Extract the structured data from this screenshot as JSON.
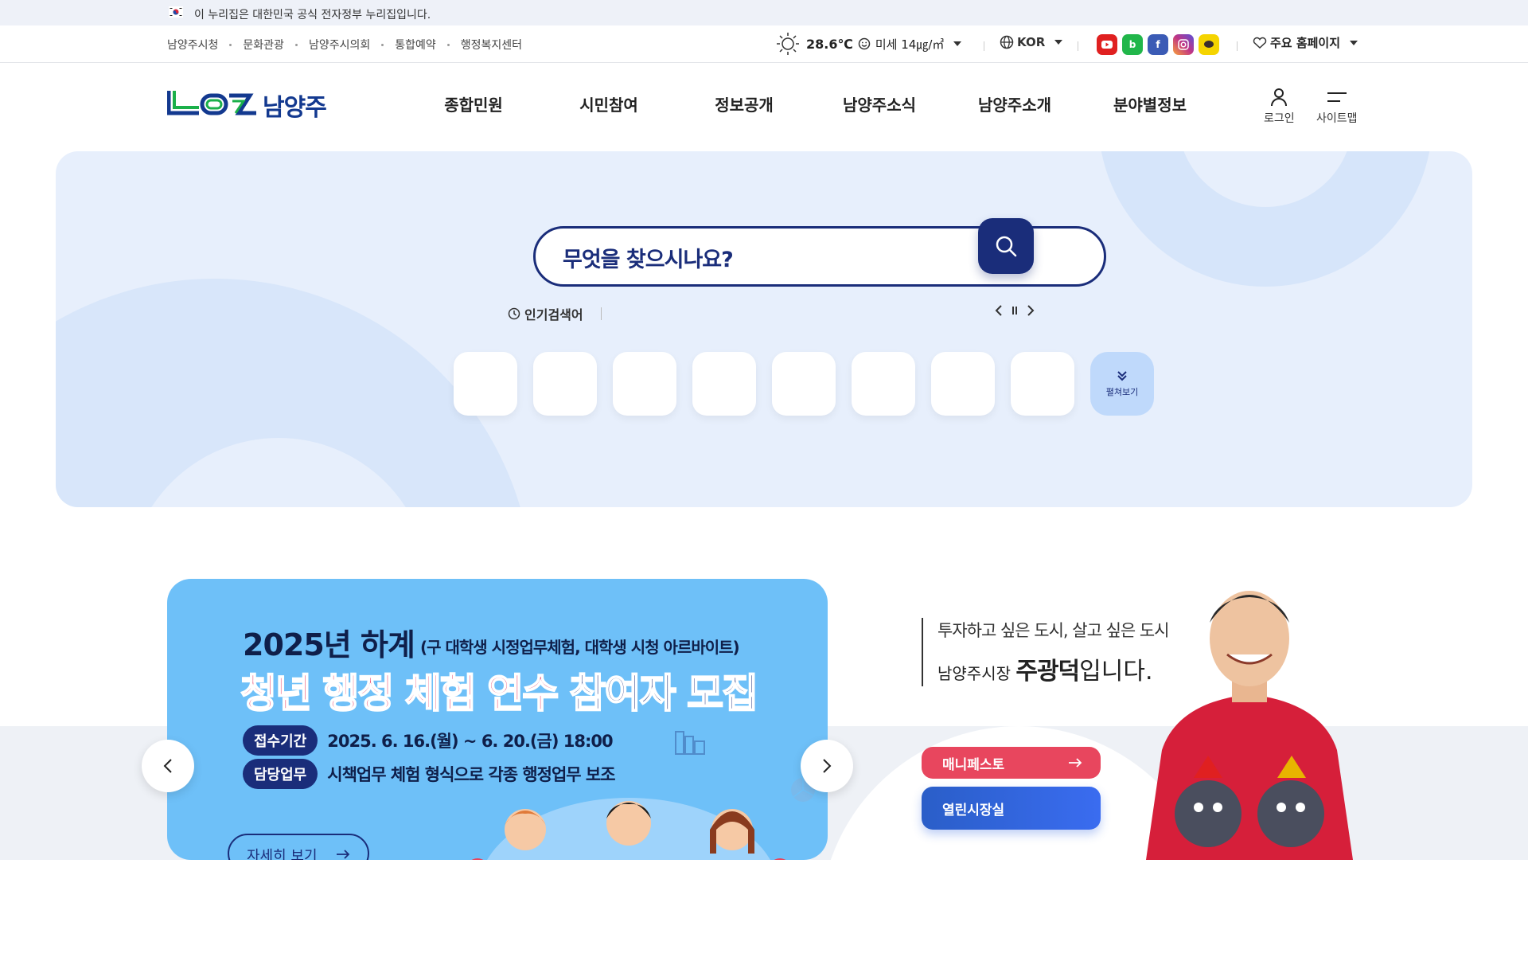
{
  "gov_banner": {
    "text": "이 누리집은 대한민국 공식 전자정부 누리집입니다."
  },
  "util_links": [
    "남양주시청",
    "문화관광",
    "남양주시의회",
    "통합예약",
    "행정복지센터"
  ],
  "weather": {
    "temperature": "28.6℃",
    "dust": "미세 14㎍/㎥"
  },
  "language": {
    "label": "KOR"
  },
  "sns": [
    {
      "name": "youtube-icon",
      "color": "#e02020"
    },
    {
      "name": "blog-icon",
      "color": "#21b64a"
    },
    {
      "name": "facebook-icon",
      "color": "#3b5bb5"
    },
    {
      "name": "instagram-icon",
      "color": "#c13584"
    },
    {
      "name": "kakao-icon",
      "color": "#f5d400"
    }
  ],
  "main_sites": {
    "label": "주요 홈페이지"
  },
  "logo": {
    "text": "남양주"
  },
  "gnb": [
    "종합민원",
    "시민참여",
    "정보공개",
    "남양주소식",
    "남양주소개",
    "분야별정보"
  ],
  "header_buttons": {
    "login": "로그인",
    "sitemap": "사이트맵"
  },
  "search": {
    "placeholder": "무엇을 찾으시나요?"
  },
  "popular": {
    "label": "인기검색어"
  },
  "quick_menu": {
    "more_label": "펼쳐보기"
  },
  "banner": {
    "year": "2025년 하계",
    "sub": "(구 대학생 시정업무체험, 대학생 시청 아르바이트)",
    "title_red": "청년 행정 체험 연수",
    "title_navy": "참여자 모집",
    "rows": [
      {
        "pill": "접수기간",
        "text": "2025. 6. 16.(월) ~ 6. 20.(금) 18:00"
      },
      {
        "pill": "담당업무",
        "text": "시책업무 체험 형식으로 각종 행정업무 보조"
      }
    ],
    "more": "자세히 보기"
  },
  "mayor": {
    "slogan": "투자하고 싶은 도시, 살고 싶은 도시",
    "title_prefix": "남양주시장",
    "name": "주광덕",
    "suffix": "입니다.",
    "buttons": {
      "manifesto": "매니페스토",
      "open_office": "열린시장실"
    }
  },
  "colors": {
    "navy": "#1a2d7a",
    "hero_bg": "#e7effc",
    "banner_bg": "#6ec0f8",
    "manifesto": "#e8465e",
    "open_office": "#2f62e0"
  }
}
